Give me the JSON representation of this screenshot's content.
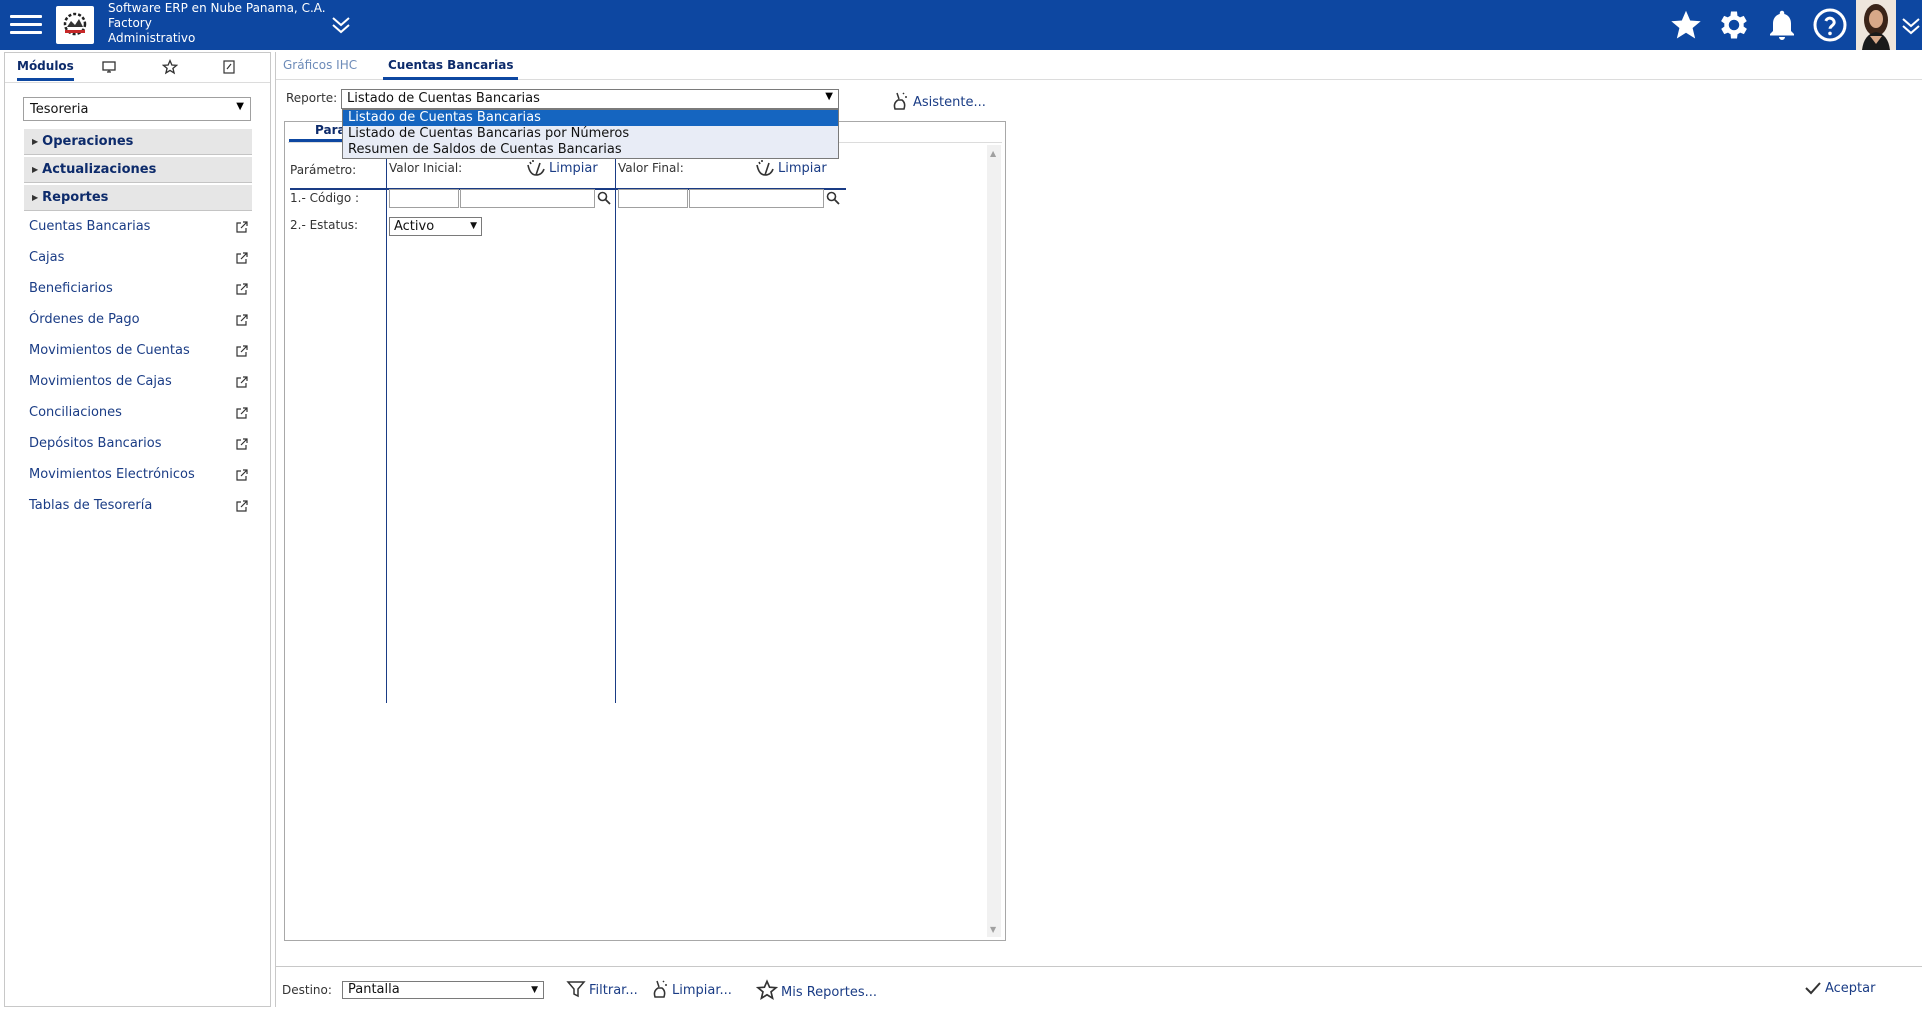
{
  "header": {
    "company_line1": "Software ERP en Nube Panama, C.A.",
    "company_line2": "Factory",
    "company_line3": "Administrativo",
    "icons": [
      "menu-icon",
      "star-icon",
      "gear-icon",
      "bell-icon",
      "help-icon",
      "chevron-double-down-icon"
    ],
    "brand_color": "#0d47a1"
  },
  "left_panel": {
    "tab_modulos": "Módulos",
    "module_selected": "Tesoreria",
    "sections": [
      "Operaciones",
      "Actualizaciones",
      "Reportes"
    ],
    "links": [
      "Cuentas Bancarias",
      "Cajas",
      "Beneficiarios",
      "Órdenes de Pago",
      "Movimientos de Cuentas",
      "Movimientos de Cajas",
      "Conciliaciones",
      "Depósitos Bancarios",
      "Movimientos Electrónicos",
      "Tablas de Tesorería"
    ]
  },
  "main": {
    "tabs": [
      "Gráficos IHC",
      "Cuentas Bancarias"
    ],
    "active_tab": "Cuentas Bancarias",
    "reporte_label": "Reporte:",
    "reporte_selected": "Listado de Cuentas Bancarias",
    "reporte_options": [
      "Listado de Cuentas Bancarias",
      "Listado de Cuentas Bancarias por Números",
      "Resumen de Saldos de Cuentas Bancarias"
    ],
    "asistente": "Asistente...",
    "param_tab": "Para",
    "col_parametro": "Parámetro:",
    "col_valor_inicial": "Valor Inicial:",
    "col_valor_final": "Valor Final:",
    "limpiar": "Limpiar",
    "param_rows": [
      "1.- Código :",
      "2.- Estatus:"
    ],
    "estatus_value": "Activo"
  },
  "bottom": {
    "destino_label": "Destino:",
    "destino_value": "Pantalla",
    "filtrar": "Filtrar...",
    "limpiar": "Limpiar...",
    "mis_reportes": "Mis Reportes...",
    "aceptar": "Aceptar"
  }
}
